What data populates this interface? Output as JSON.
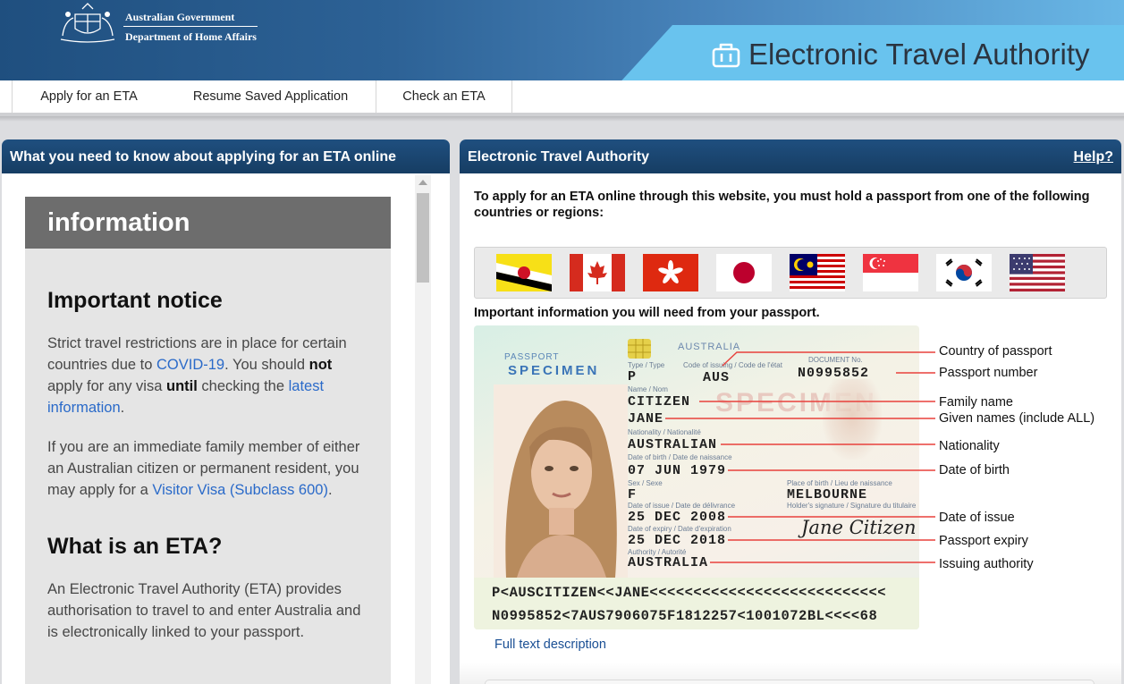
{
  "header": {
    "gov_line1": "Australian Government",
    "gov_line2": "Department of Home Affairs",
    "app_title": "Electronic Travel Authority",
    "logo_icon": "briefcase-icon"
  },
  "nav": {
    "items": [
      {
        "label": "Apply for an ETA"
      },
      {
        "label": "Resume Saved Application"
      },
      {
        "label": "Check an ETA"
      }
    ]
  },
  "left_panel": {
    "title": "What you need to know about applying for an ETA online",
    "info_heading": "information",
    "notice_heading": "Important notice",
    "notice_p1": {
      "t1": "Strict travel restrictions are in place for certain countries due to ",
      "link1": "COVID-19",
      "t2": ". You should ",
      "b1": "not",
      "t3": " apply for any visa ",
      "b2": "until",
      "t4": " checking the ",
      "link2": "latest information",
      "t5": "."
    },
    "notice_p2": {
      "t1": "If you are an immediate family member of either an Australian citizen or permanent resident, you may apply for a ",
      "link": "Visitor Visa (Subclass 600)",
      "t2": "."
    },
    "eta_heading": "What is an ETA?",
    "eta_p": "An Electronic Travel Authority (ETA) provides authorisation to travel to and enter Australia and is electronically linked to your passport."
  },
  "right_panel": {
    "title": "Electronic Travel Authority",
    "help": "Help?",
    "intro": "To apply for an ETA online through this website, you must hold a passport from one of the following countries or regions:",
    "flags": [
      "Brunei",
      "Canada",
      "Hong Kong",
      "Japan",
      "Malaysia",
      "Singapore",
      "South Korea",
      "United States"
    ],
    "passport_label": "Important information you will need from your passport.",
    "passport": {
      "header": "PASSPORT",
      "specimen": "SPECIMEN",
      "country": "AUSTRALIA",
      "type_label": "Type / Type",
      "type": "P",
      "code_label": "Code of issuing / Code de l'état",
      "code": "AUS",
      "doc_label": "DOCUMENT No.",
      "doc_no": "N0995852",
      "name_label": "Name / Nom",
      "surname": "CITIZEN",
      "given": "JANE",
      "nat_label": "Nationality / Nationalité",
      "nationality": "AUSTRALIAN",
      "dob_label": "Date of birth / Date de naissance",
      "dob": "07 JUN 1979",
      "sex_label": "Sex / Sexe",
      "sex": "F",
      "pob_label": "Place of birth / Lieu de naissance",
      "pob": "MELBOURNE",
      "sig_label": "Holder's signature / Signature du titulaire",
      "signature": "Jane Citizen",
      "issue_label": "Date of issue / Date de délivrance",
      "issue": "25 DEC 2008",
      "expiry_label": "Date of expiry / Date d'expiration",
      "expiry": "25 DEC 2018",
      "auth_label": "Authority / Autorité",
      "authority": "AUSTRALIA",
      "watermark": "SPECIMEN",
      "mrz1": "P<AUSCITIZEN<<JANE<<<<<<<<<<<<<<<<<<<<<<<<<<<",
      "mrz2": "N0995852<7AUS7906075F1812257<1001072BL<<<<68"
    },
    "callouts": [
      "Country of passport",
      "Passport number",
      "Family name",
      "Given names (include ALL)",
      "Nationality",
      "Date of birth",
      "Date of issue",
      "Passport expiry",
      "Issuing authority"
    ],
    "full_text_link": "Full text description"
  }
}
